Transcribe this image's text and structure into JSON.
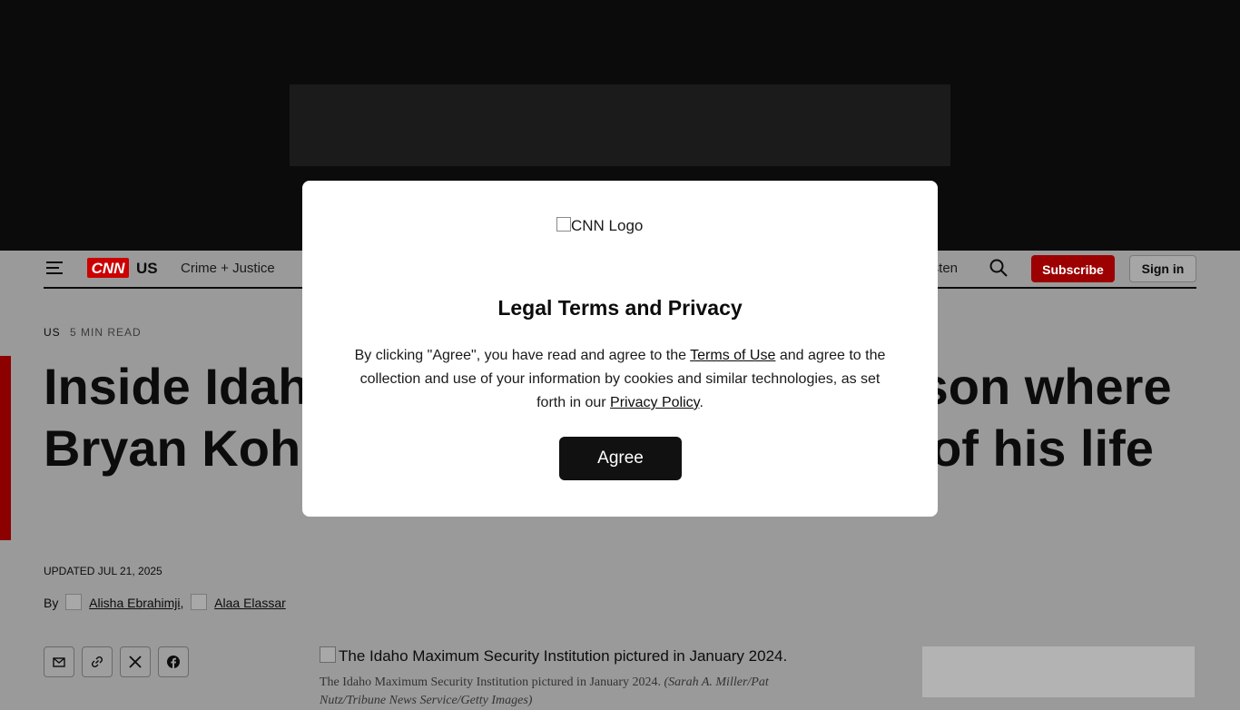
{
  "header": {
    "section": "US",
    "nav_link": "Crime + Justice",
    "listen": "Listen",
    "subscribe_label": "Subscribe",
    "signin_label": "Sign in",
    "brand_color": "#cc0000",
    "logo_text": "CNN"
  },
  "article": {
    "section": "US",
    "read_time": "5 MIN READ",
    "headline": "Inside Idaho's maximum security prison where Bryan Kohberger will spend the rest of his life",
    "updated": "UPDATED JUL 21, 2025",
    "by_label": "By",
    "authors": [
      "Alisha Ebrahimji",
      "Alaa Elassar"
    ],
    "author_separator": ",",
    "image_alt": "The Idaho Maximum Security Institution pictured in January 2024.",
    "caption": "The Idaho Maximum Security Institution pictured in January 2024.",
    "caption_credit": "(Sarah A. Miller/Pat Nutz/Tribune News Service/Getty Images)"
  },
  "share_icons": [
    "mail-icon",
    "link-icon",
    "x-icon",
    "facebook-icon"
  ],
  "modal": {
    "logo_alt": "CNN Logo",
    "title": "Legal Terms and Privacy",
    "body_before": "By clicking \"Agree\", you have read and agree to the ",
    "terms_link": "Terms of Use",
    "body_middle": " and agree to the collection and use of your information by cookies and similar technologies, as set forth in our ",
    "privacy_link": "Privacy Policy",
    "body_after": ".",
    "agree_label": "Agree"
  }
}
